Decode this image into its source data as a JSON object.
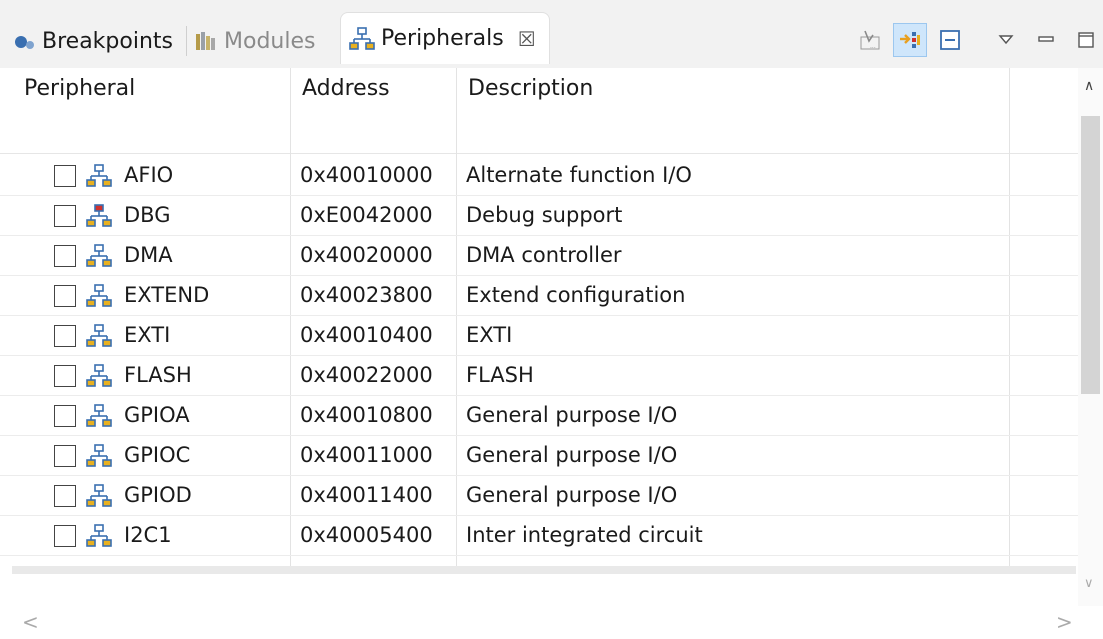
{
  "tabs": {
    "breakpoints": "Breakpoints",
    "modules": "Modules",
    "peripherals": "Peripherals",
    "close_glyph": "☒"
  },
  "toolbar": {
    "icons": [
      "remove-all-icon",
      "link-icon",
      "collapse-all-icon",
      "view-menu-icon",
      "minimize-icon",
      "maximize-icon"
    ],
    "active_color": "#cfe6fb"
  },
  "table": {
    "columns": [
      "Peripheral",
      "Address",
      "Description"
    ],
    "rows": [
      {
        "name": "AFIO",
        "address": "0x40010000",
        "description": "Alternate function I/O",
        "icon": "peripheral-icon",
        "checked": false
      },
      {
        "name": "DBG",
        "address": "0xE0042000",
        "description": "Debug support",
        "icon": "peripheral-red-icon",
        "checked": false
      },
      {
        "name": "DMA",
        "address": "0x40020000",
        "description": "DMA controller",
        "icon": "peripheral-icon",
        "checked": false
      },
      {
        "name": "EXTEND",
        "address": "0x40023800",
        "description": "Extend configuration",
        "icon": "peripheral-icon",
        "checked": false
      },
      {
        "name": "EXTI",
        "address": "0x40010400",
        "description": "EXTI",
        "icon": "peripheral-icon",
        "checked": false
      },
      {
        "name": "FLASH",
        "address": "0x40022000",
        "description": "FLASH",
        "icon": "peripheral-icon",
        "checked": false
      },
      {
        "name": "GPIOA",
        "address": "0x40010800",
        "description": "General purpose I/O",
        "icon": "peripheral-icon",
        "checked": false
      },
      {
        "name": "GPIOC",
        "address": "0x40011000",
        "description": "General purpose I/O",
        "icon": "peripheral-icon",
        "checked": false
      },
      {
        "name": "GPIOD",
        "address": "0x40011400",
        "description": "General purpose I/O",
        "icon": "peripheral-icon",
        "checked": false
      },
      {
        "name": "I2C1",
        "address": "0x40005400",
        "description": "Inter integrated circuit",
        "icon": "peripheral-icon",
        "checked": false
      }
    ]
  },
  "colors": {
    "icon_blue": "#3a6fb0",
    "icon_yellow": "#e8b020",
    "icon_red": "#d0312d"
  }
}
